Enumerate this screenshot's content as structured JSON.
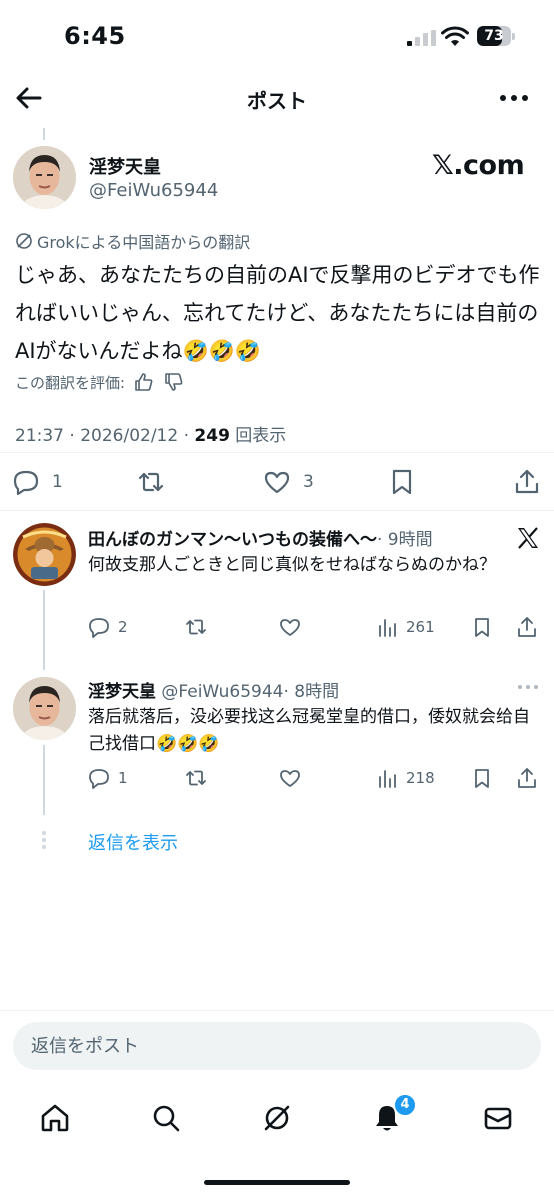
{
  "status_bar": {
    "time": "6:45",
    "battery": "73",
    "battery_level": 0.73
  },
  "nav": {
    "title": "ポスト"
  },
  "post": {
    "author_name": "淫梦天皇",
    "author_handle": "@FeiWu65944",
    "source_label": "𝕏.com",
    "translation_label": "Grokによる中国語からの翻訳",
    "text": "じゃあ、あなたたちの自前のAIで反撃用のビデオでも作ればいいじゃん、忘れてたけど、あなたたちには自前のAIがないんだよね🤣🤣🤣",
    "rate_label": "この翻訳を評価:",
    "timestamp": "21:37 · 2026/02/12 · ",
    "views_count": "249",
    "views_label": " 回表示",
    "replies": "1",
    "likes": "3"
  },
  "replies": [
    {
      "name": "田んぼのガンマン〜いつもの装備へ〜",
      "handle": "",
      "time": "· 9時間",
      "text": "何故支那人ごときと同じ真似をせねばならぬのかね？",
      "replies": "2",
      "views": "261"
    },
    {
      "name": "淫梦天皇",
      "handle": "@FeiWu65944",
      "time": "· 8時間",
      "text": "落后就落后，没必要找这么冠冕堂皇的借口，倭奴就会给自己找借口🤣🤣🤣",
      "replies": "1",
      "views": "218"
    }
  ],
  "show_replies": "返信を表示",
  "compose": {
    "placeholder": "返信をポスト"
  },
  "tabs": {
    "notifications_badge": "4"
  }
}
